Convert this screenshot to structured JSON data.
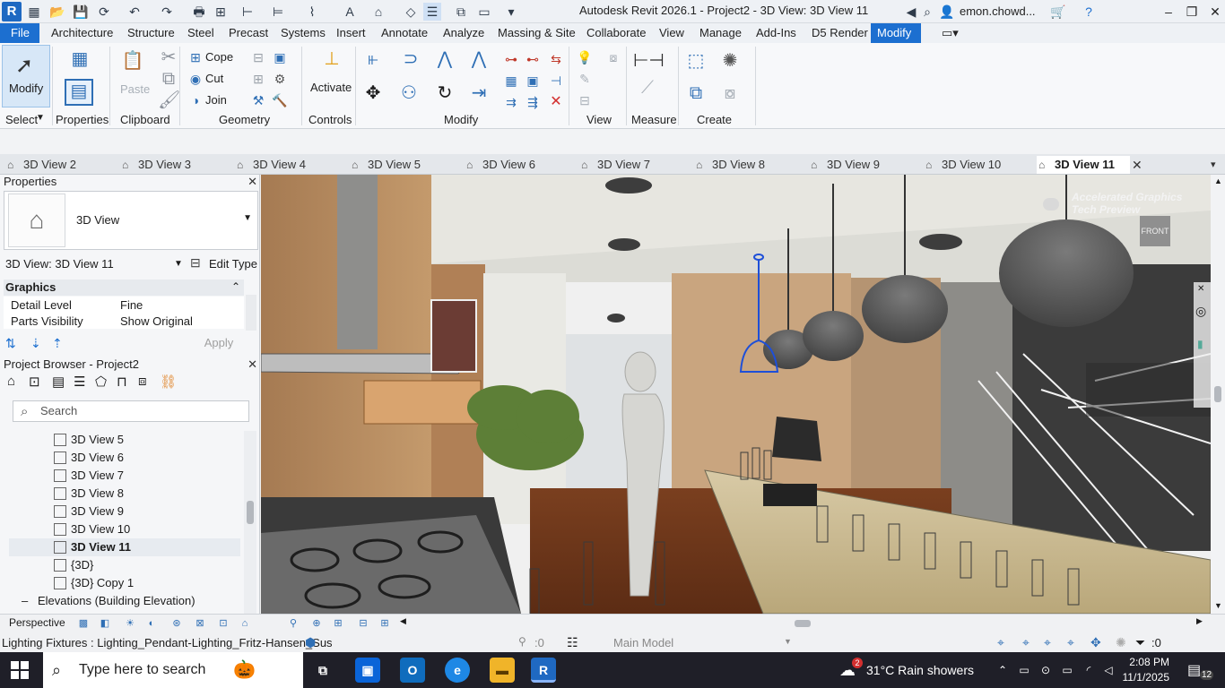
{
  "title_bar": {
    "window_title": "Autodesk Revit 2026.1 - Project2 - 3D View: 3D View 11",
    "user": "emon.chowd...",
    "logo_letter": "R"
  },
  "ribbon_tabs": [
    "File",
    "Architecture",
    "Structure",
    "Steel",
    "Precast",
    "Systems",
    "Insert",
    "Annotate",
    "Analyze",
    "Massing & Site",
    "Collaborate",
    "View",
    "Manage",
    "Add-Ins",
    "D5 Render",
    "Modify"
  ],
  "ribbon": {
    "modify_label": "Modify",
    "panels": [
      "Select",
      "Properties",
      "Clipboard",
      "Geometry",
      "Controls",
      "Modify",
      "View",
      "Measure",
      "Create"
    ],
    "paste_label": "Paste",
    "cope_label": "Cope",
    "cut_label": "Cut",
    "join_label": "Join",
    "activate_label": "Activate"
  },
  "view_tabs": [
    "3D View 2",
    "3D View 3",
    "3D View 4",
    "3D View 5",
    "3D View 6",
    "3D View 7",
    "3D View 8",
    "3D View 9",
    "3D View 10",
    "3D View 11"
  ],
  "properties": {
    "header": "Properties",
    "type_name": "3D View",
    "instance_selector": "3D View: 3D View 11",
    "edit_type": "Edit Type",
    "group": "Graphics",
    "rows": [
      {
        "key": "Detail Level",
        "value": "Fine"
      },
      {
        "key": "Parts Visibility",
        "value": "Show Original"
      }
    ],
    "apply": "Apply"
  },
  "browser": {
    "header": "Project Browser - Project2",
    "search_placeholder": "Search",
    "items": [
      "3D View 5",
      "3D View 6",
      "3D View 7",
      "3D View 8",
      "3D View 9",
      "3D View 10",
      "3D View 11",
      "{3D}",
      "{3D} Copy 1"
    ],
    "selected_index": 6,
    "group_after": "Elevations (Building Elevation)"
  },
  "viewport": {
    "watermark_line1": "Accelerated Graphics",
    "watermark_line2": "Tech Preview",
    "viewcube_label": "FRONT"
  },
  "view_control": {
    "label": "Perspective"
  },
  "status_bar": {
    "text": "Lighting Fixtures : Lighting_Pendant-Lighting_Fritz-Hansen_Sus",
    "count": ":0",
    "model": "Main Model",
    "filter": ":0"
  },
  "taskbar": {
    "search_placeholder": "Type here to search",
    "weather": "31°C  Rain showers",
    "weather_badge": "2",
    "time": "2:08 PM",
    "date": "11/1/2025",
    "notifications": "12"
  },
  "colors": {
    "accent": "#1c6fd0",
    "selected_fixture": "#1e4fd8",
    "taskbar": "#1f1f28"
  }
}
